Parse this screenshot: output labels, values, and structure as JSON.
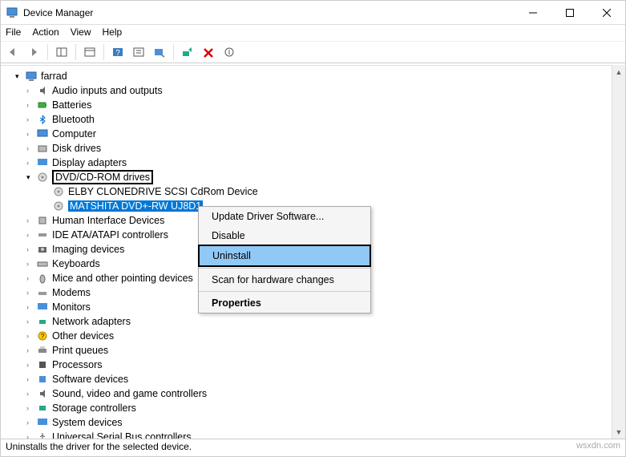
{
  "window": {
    "title": "Device Manager"
  },
  "menu": {
    "file": "File",
    "action": "Action",
    "view": "View",
    "help": "Help"
  },
  "tree": {
    "root": "farrad",
    "audio": "Audio inputs and outputs",
    "batteries": "Batteries",
    "bluetooth": "Bluetooth",
    "computer": "Computer",
    "disk": "Disk drives",
    "display": "Display adapters",
    "dvd": "DVD/CD-ROM drives",
    "dvd_c1": "ELBY CLONEDRIVE SCSI CdRom Device",
    "dvd_c2": "MATSHITA DVD+-RW UJ8D1",
    "hid": "Human Interface Devices",
    "ide": "IDE ATA/ATAPI controllers",
    "imaging": "Imaging devices",
    "keyboards": "Keyboards",
    "mice": "Mice and other pointing devices",
    "modems": "Modems",
    "monitors": "Monitors",
    "network": "Network adapters",
    "other": "Other devices",
    "print": "Print queues",
    "processors": "Processors",
    "software": "Software devices",
    "sound": "Sound, video and game controllers",
    "storage": "Storage controllers",
    "system": "System devices",
    "usb": "Universal Serial Bus controllers"
  },
  "context": {
    "update": "Update Driver Software...",
    "disable": "Disable",
    "uninstall": "Uninstall",
    "scan": "Scan for hardware changes",
    "properties": "Properties"
  },
  "status": {
    "text": "Uninstalls the driver for the selected device.",
    "watermark": "wsxdn.com"
  }
}
